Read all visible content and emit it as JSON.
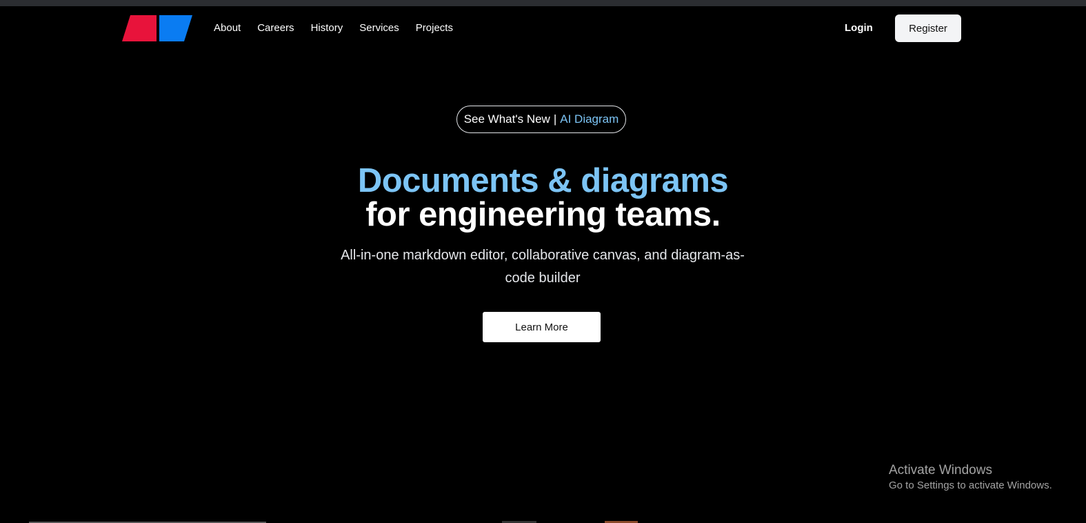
{
  "nav": {
    "logo": {
      "icon": "parallelogram-logo",
      "left_color": "#e8133b",
      "right_color": "#0a7cf2"
    },
    "links": [
      {
        "label": "About"
      },
      {
        "label": "Careers"
      },
      {
        "label": "History"
      },
      {
        "label": "Services"
      },
      {
        "label": "Projects"
      }
    ],
    "login_label": "Login",
    "register_label": "Register"
  },
  "hero": {
    "badge": {
      "prefix": "See What's New",
      "separator": "|",
      "highlight": "AI Diagram"
    },
    "headline_line1": "Documents & diagrams",
    "headline_line2": "for engineering teams.",
    "subtitle": "All-in-one markdown editor, collaborative canvas, and diagram-as-code builder",
    "cta_label": "Learn More"
  },
  "windows_watermark": {
    "title": "Activate Windows",
    "subtitle": "Go to Settings to activate Windows."
  },
  "colors": {
    "background": "#000000",
    "accent": "#7cc4f5",
    "logo_red": "#e8133b",
    "logo_blue": "#0a7cf2"
  }
}
